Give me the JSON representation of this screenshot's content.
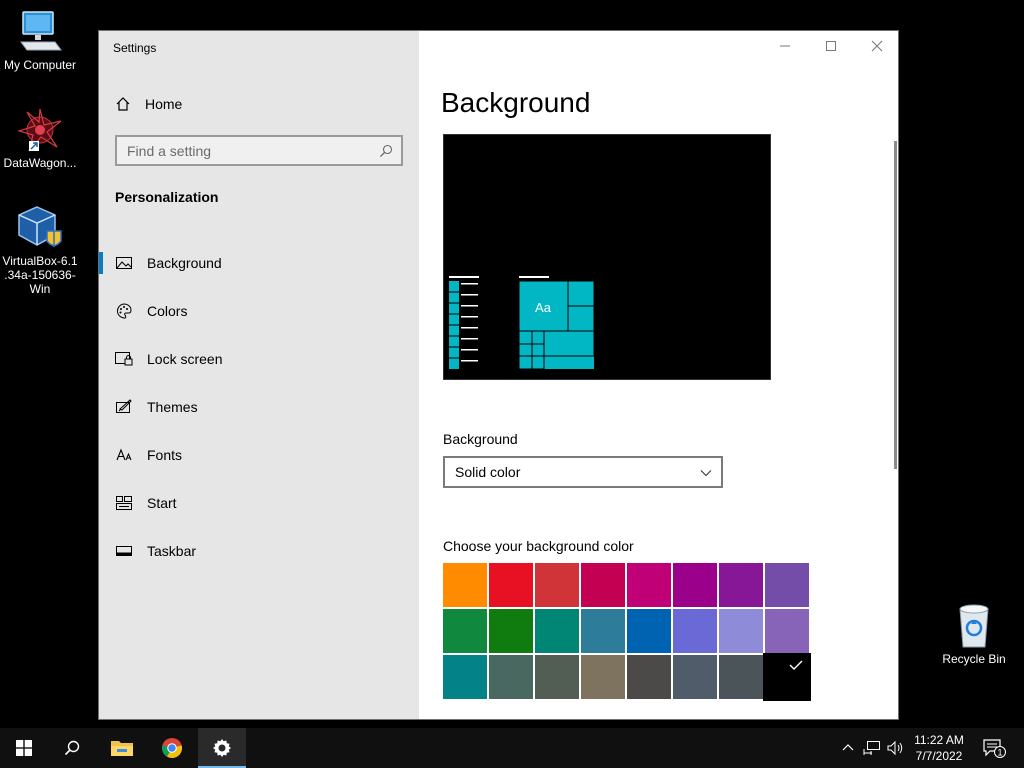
{
  "desktop": {
    "icons": [
      {
        "label": "My Computer"
      },
      {
        "label": "DataWagon..."
      },
      {
        "label": "VirtualBox-6.1\n.34a-150636-\nWin"
      },
      {
        "label": "Recycle Bin"
      }
    ]
  },
  "window": {
    "title": "Settings",
    "controls": {
      "minimize": "minimize-icon",
      "maximize": "maximize-icon",
      "close": "close-icon"
    }
  },
  "sidebar": {
    "home_label": "Home",
    "search_placeholder": "Find a setting",
    "section_title": "Personalization",
    "items": [
      {
        "label": "Background",
        "icon": "image-icon",
        "active": true
      },
      {
        "label": "Colors",
        "icon": "palette-icon"
      },
      {
        "label": "Lock screen",
        "icon": "lock-screen-icon"
      },
      {
        "label": "Themes",
        "icon": "themes-icon"
      },
      {
        "label": "Fonts",
        "icon": "fonts-icon"
      },
      {
        "label": "Start",
        "icon": "start-icon"
      },
      {
        "label": "Taskbar",
        "icon": "taskbar-icon"
      }
    ]
  },
  "main": {
    "page_title": "Background",
    "preview_text": "Aa",
    "background_label": "Background",
    "background_value": "Solid color",
    "color_label": "Choose your background color",
    "colors": [
      "#ff8c00",
      "#e81123",
      "#d13438",
      "#c30052",
      "#bf0077",
      "#9a0089",
      "#881798",
      "#744da9",
      "#10893e",
      "#107c10",
      "#018574",
      "#2d7d9a",
      "#0063b1",
      "#6b69d6",
      "#8e8cd8",
      "#8764b8",
      "#038387",
      "#486860",
      "#525e54",
      "#7e735f",
      "#4c4a48",
      "#515c6b",
      "#4a5459",
      "#000000"
    ],
    "selected_color_index": 23
  },
  "taskbar": {
    "time": "11:22 AM",
    "date": "7/7/2022",
    "notification_count": "1"
  },
  "accent": "#00b7c3"
}
